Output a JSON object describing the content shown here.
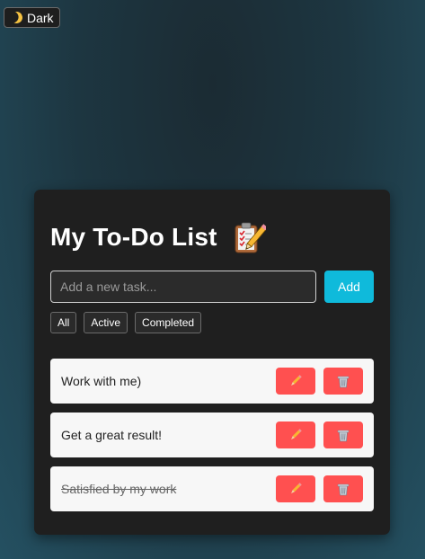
{
  "theme_toggle": {
    "label": "Dark",
    "icon": "moon-icon"
  },
  "app": {
    "title": "My To-Do List",
    "title_icon": "clipboard-checklist-icon"
  },
  "new_task": {
    "placeholder": "Add a new task...",
    "value": "",
    "add_label": "Add"
  },
  "filters": [
    {
      "label": "All"
    },
    {
      "label": "Active"
    },
    {
      "label": "Completed"
    }
  ],
  "tasks": [
    {
      "text": "Work with me)",
      "completed": false
    },
    {
      "text": "Get a great result!",
      "completed": false
    },
    {
      "text": "Satisfied by my work",
      "completed": true
    }
  ],
  "colors": {
    "accent": "#0fbadb",
    "danger": "#ff5050",
    "card": "#1f1f1f",
    "task_bg": "#f7f7f7"
  }
}
